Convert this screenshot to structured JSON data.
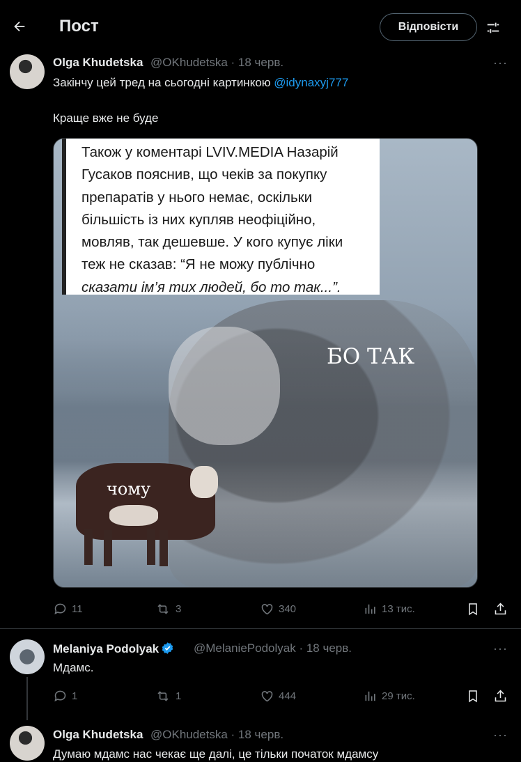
{
  "header": {
    "title": "Пост",
    "reply_label": "Відповісти"
  },
  "posts": [
    {
      "name": "Olga Khudetska",
      "handle": "@OKhudetska · 18 черв.",
      "text_prefix": "Закінчу цей тред на сьогодні картинкою ",
      "mention": "@idynaxyj777",
      "text2": "Краще вже не буде",
      "more": "···",
      "image": {
        "quote_lines": [
          "Також у коментарі LVIV.MEDIA Назарій",
          "Гусаков пояснив, що чеків за покупку",
          "препаратів у нього немає, оскільки",
          "більшість із них купляв неофіційно,",
          "мовляв, так дешевше. У кого купує ліки",
          "теж не сказав: “Я не можу публічно",
          "сказати ім’я тих людей, бо то так...”."
        ],
        "caption_big": "БО ТАК",
        "caption_small": "чому"
      },
      "stats": {
        "replies": "11",
        "reposts": "3",
        "likes": "340",
        "views": "13 тис."
      }
    },
    {
      "name": "Melaniya Podolyak",
      "handle": "@MelaniePodolyak · 18 черв.",
      "text": "Мдамс.",
      "more": "···",
      "stats": {
        "replies": "1",
        "reposts": "1",
        "likes": "444",
        "views": "29 тис."
      }
    },
    {
      "name": "Olga Khudetska",
      "handle": "@OKhudetska · 18 черв.",
      "text": "Думаю мдамс нас чекає ще далі, це тільки початок мдамсу",
      "more": "···"
    }
  ],
  "colors": {
    "background": "#000000",
    "text": "#e7e9ea",
    "muted": "#71767b",
    "link": "#1d9bf0",
    "verified": "#1d9bf0"
  },
  "icons": [
    "back-arrow-icon",
    "filter-icon",
    "more-icon",
    "reply-icon",
    "repost-icon",
    "like-icon",
    "views-icon",
    "bookmark-icon",
    "share-icon",
    "verified-icon"
  ]
}
